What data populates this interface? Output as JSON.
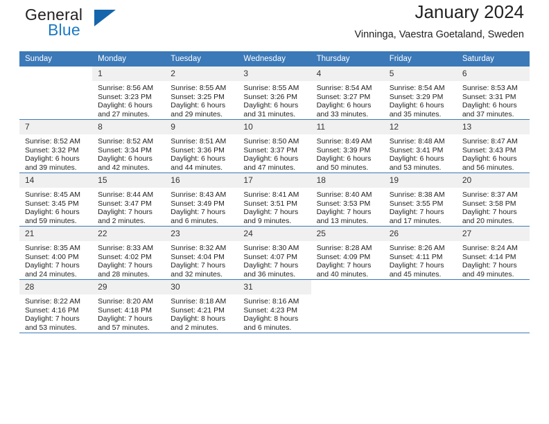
{
  "brand": {
    "word_one": "General",
    "word_two": "Blue",
    "flag_icon": "triangle-flag-icon",
    "accent_color": "#1d79c4",
    "flag_color": "#1565ad"
  },
  "header": {
    "title": "January 2024",
    "subtitle": "Vinninga, Vaestra Goetaland, Sweden"
  },
  "calendar": {
    "header_color": "#3b79b8",
    "weekdays": [
      "Sunday",
      "Monday",
      "Tuesday",
      "Wednesday",
      "Thursday",
      "Friday",
      "Saturday"
    ],
    "weeks": [
      [
        {
          "day": "",
          "lines": []
        },
        {
          "day": "1",
          "lines": [
            "Sunrise: 8:56 AM",
            "Sunset: 3:23 PM",
            "Daylight: 6 hours",
            "and 27 minutes."
          ]
        },
        {
          "day": "2",
          "lines": [
            "Sunrise: 8:55 AM",
            "Sunset: 3:25 PM",
            "Daylight: 6 hours",
            "and 29 minutes."
          ]
        },
        {
          "day": "3",
          "lines": [
            "Sunrise: 8:55 AM",
            "Sunset: 3:26 PM",
            "Daylight: 6 hours",
            "and 31 minutes."
          ]
        },
        {
          "day": "4",
          "lines": [
            "Sunrise: 8:54 AM",
            "Sunset: 3:27 PM",
            "Daylight: 6 hours",
            "and 33 minutes."
          ]
        },
        {
          "day": "5",
          "lines": [
            "Sunrise: 8:54 AM",
            "Sunset: 3:29 PM",
            "Daylight: 6 hours",
            "and 35 minutes."
          ]
        },
        {
          "day": "6",
          "lines": [
            "Sunrise: 8:53 AM",
            "Sunset: 3:31 PM",
            "Daylight: 6 hours",
            "and 37 minutes."
          ]
        }
      ],
      [
        {
          "day": "7",
          "lines": [
            "Sunrise: 8:52 AM",
            "Sunset: 3:32 PM",
            "Daylight: 6 hours",
            "and 39 minutes."
          ]
        },
        {
          "day": "8",
          "lines": [
            "Sunrise: 8:52 AM",
            "Sunset: 3:34 PM",
            "Daylight: 6 hours",
            "and 42 minutes."
          ]
        },
        {
          "day": "9",
          "lines": [
            "Sunrise: 8:51 AM",
            "Sunset: 3:36 PM",
            "Daylight: 6 hours",
            "and 44 minutes."
          ]
        },
        {
          "day": "10",
          "lines": [
            "Sunrise: 8:50 AM",
            "Sunset: 3:37 PM",
            "Daylight: 6 hours",
            "and 47 minutes."
          ]
        },
        {
          "day": "11",
          "lines": [
            "Sunrise: 8:49 AM",
            "Sunset: 3:39 PM",
            "Daylight: 6 hours",
            "and 50 minutes."
          ]
        },
        {
          "day": "12",
          "lines": [
            "Sunrise: 8:48 AM",
            "Sunset: 3:41 PM",
            "Daylight: 6 hours",
            "and 53 minutes."
          ]
        },
        {
          "day": "13",
          "lines": [
            "Sunrise: 8:47 AM",
            "Sunset: 3:43 PM",
            "Daylight: 6 hours",
            "and 56 minutes."
          ]
        }
      ],
      [
        {
          "day": "14",
          "lines": [
            "Sunrise: 8:45 AM",
            "Sunset: 3:45 PM",
            "Daylight: 6 hours",
            "and 59 minutes."
          ]
        },
        {
          "day": "15",
          "lines": [
            "Sunrise: 8:44 AM",
            "Sunset: 3:47 PM",
            "Daylight: 7 hours",
            "and 2 minutes."
          ]
        },
        {
          "day": "16",
          "lines": [
            "Sunrise: 8:43 AM",
            "Sunset: 3:49 PM",
            "Daylight: 7 hours",
            "and 6 minutes."
          ]
        },
        {
          "day": "17",
          "lines": [
            "Sunrise: 8:41 AM",
            "Sunset: 3:51 PM",
            "Daylight: 7 hours",
            "and 9 minutes."
          ]
        },
        {
          "day": "18",
          "lines": [
            "Sunrise: 8:40 AM",
            "Sunset: 3:53 PM",
            "Daylight: 7 hours",
            "and 13 minutes."
          ]
        },
        {
          "day": "19",
          "lines": [
            "Sunrise: 8:38 AM",
            "Sunset: 3:55 PM",
            "Daylight: 7 hours",
            "and 17 minutes."
          ]
        },
        {
          "day": "20",
          "lines": [
            "Sunrise: 8:37 AM",
            "Sunset: 3:58 PM",
            "Daylight: 7 hours",
            "and 20 minutes."
          ]
        }
      ],
      [
        {
          "day": "21",
          "lines": [
            "Sunrise: 8:35 AM",
            "Sunset: 4:00 PM",
            "Daylight: 7 hours",
            "and 24 minutes."
          ]
        },
        {
          "day": "22",
          "lines": [
            "Sunrise: 8:33 AM",
            "Sunset: 4:02 PM",
            "Daylight: 7 hours",
            "and 28 minutes."
          ]
        },
        {
          "day": "23",
          "lines": [
            "Sunrise: 8:32 AM",
            "Sunset: 4:04 PM",
            "Daylight: 7 hours",
            "and 32 minutes."
          ]
        },
        {
          "day": "24",
          "lines": [
            "Sunrise: 8:30 AM",
            "Sunset: 4:07 PM",
            "Daylight: 7 hours",
            "and 36 minutes."
          ]
        },
        {
          "day": "25",
          "lines": [
            "Sunrise: 8:28 AM",
            "Sunset: 4:09 PM",
            "Daylight: 7 hours",
            "and 40 minutes."
          ]
        },
        {
          "day": "26",
          "lines": [
            "Sunrise: 8:26 AM",
            "Sunset: 4:11 PM",
            "Daylight: 7 hours",
            "and 45 minutes."
          ]
        },
        {
          "day": "27",
          "lines": [
            "Sunrise: 8:24 AM",
            "Sunset: 4:14 PM",
            "Daylight: 7 hours",
            "and 49 minutes."
          ]
        }
      ],
      [
        {
          "day": "28",
          "lines": [
            "Sunrise: 8:22 AM",
            "Sunset: 4:16 PM",
            "Daylight: 7 hours",
            "and 53 minutes."
          ]
        },
        {
          "day": "29",
          "lines": [
            "Sunrise: 8:20 AM",
            "Sunset: 4:18 PM",
            "Daylight: 7 hours",
            "and 57 minutes."
          ]
        },
        {
          "day": "30",
          "lines": [
            "Sunrise: 8:18 AM",
            "Sunset: 4:21 PM",
            "Daylight: 8 hours",
            "and 2 minutes."
          ]
        },
        {
          "day": "31",
          "lines": [
            "Sunrise: 8:16 AM",
            "Sunset: 4:23 PM",
            "Daylight: 8 hours",
            "and 6 minutes."
          ]
        },
        {
          "day": "",
          "lines": []
        },
        {
          "day": "",
          "lines": []
        },
        {
          "day": "",
          "lines": []
        }
      ]
    ]
  }
}
